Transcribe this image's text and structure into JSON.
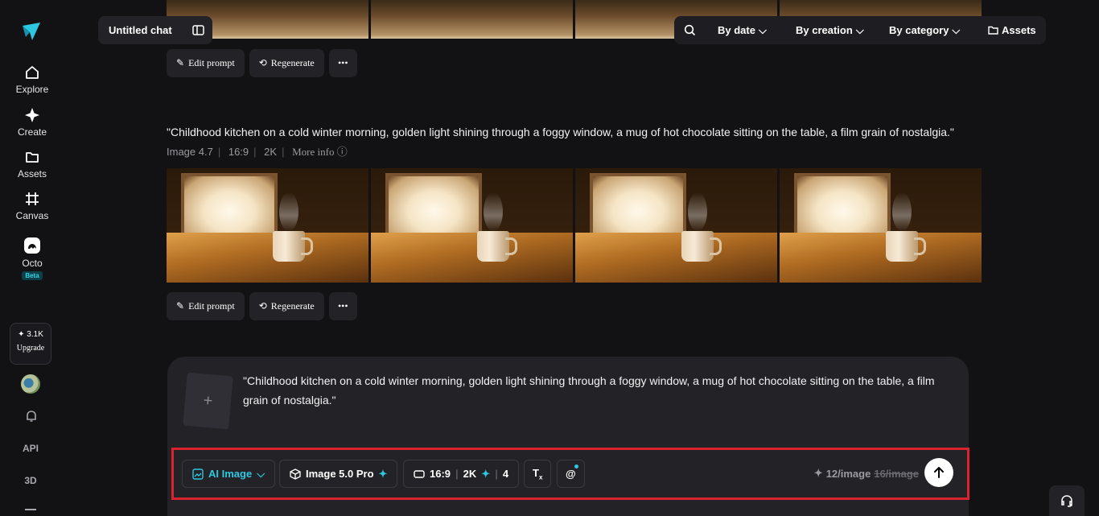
{
  "sidebar": {
    "items": [
      {
        "label": "Explore"
      },
      {
        "label": "Create"
      },
      {
        "label": "Assets"
      },
      {
        "label": "Canvas"
      },
      {
        "label": "Octo",
        "badge": "Beta"
      }
    ],
    "credits": "3.1K",
    "upgrade_label": "Upgrade",
    "api_label": "API",
    "threed_label": "3D"
  },
  "header": {
    "chat_title": "Untitled chat",
    "filters": [
      "By date",
      "By creation",
      "By category"
    ],
    "assets_label": "Assets"
  },
  "generations": [
    {
      "actions": {
        "edit": "Edit prompt",
        "regenerate": "Regenerate"
      }
    },
    {
      "prompt": "\"Childhood kitchen on a cold winter morning, golden light shining through a foggy window, a mug of hot chocolate sitting on the table, a film grain of nostalgia.\"",
      "meta": {
        "model": "Image 4.7",
        "ratio": "16:9",
        "resolution": "2K",
        "more": "More info"
      },
      "actions": {
        "edit": "Edit prompt",
        "regenerate": "Regenerate"
      }
    }
  ],
  "composer": {
    "text": "\"Childhood kitchen on a cold winter morning, golden light shining through a foggy window, a mug of hot chocolate sitting on the table, a film grain of nostalgia.\"",
    "mode": "AI Image",
    "model": "Image 5.0 Pro",
    "ratio": "16:9",
    "resolution": "2K",
    "count": "4",
    "cost": "12/image",
    "old_cost": "16/image"
  },
  "colors": {
    "accent": "#2cc7e0",
    "highlight_border": "#d9242f",
    "background": "#121214"
  }
}
